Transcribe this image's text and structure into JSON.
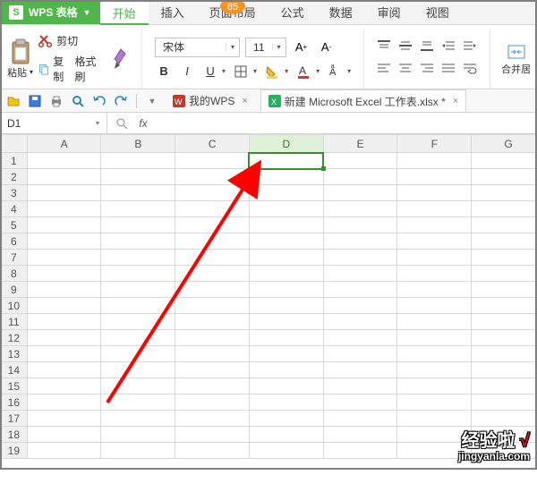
{
  "menubar": {
    "brand": "WPS 表格",
    "badge": "85",
    "tabs": [
      "开始",
      "插入",
      "页面布局",
      "公式",
      "数据",
      "审阅",
      "视图"
    ],
    "active_index": 0
  },
  "ribbon": {
    "clipboard": {
      "paste": "粘贴",
      "cut": "剪切",
      "copy": "复制",
      "fmt": "格式刷"
    },
    "font": {
      "name": "宋体",
      "size": "11",
      "buttons": {
        "bold": "B",
        "italic": "I",
        "underline": "U"
      }
    },
    "align": {},
    "merge": "合并居"
  },
  "qat": {
    "doc1": "我的WPS",
    "doc2": "新建 Microsoft Excel 工作表.xlsx *"
  },
  "fx": {
    "namebox": "D1",
    "fx": "fx"
  },
  "grid": {
    "cols": [
      "A",
      "B",
      "C",
      "D",
      "E",
      "F",
      "G"
    ],
    "rows": 19,
    "sel_col_index": 3,
    "sel_row": 1
  },
  "watermark": {
    "l1a": "经验啦",
    "l1b": "√",
    "l2": "jingyanla.com"
  },
  "annotation": {
    "type": "arrow",
    "color": "#ff0000"
  }
}
